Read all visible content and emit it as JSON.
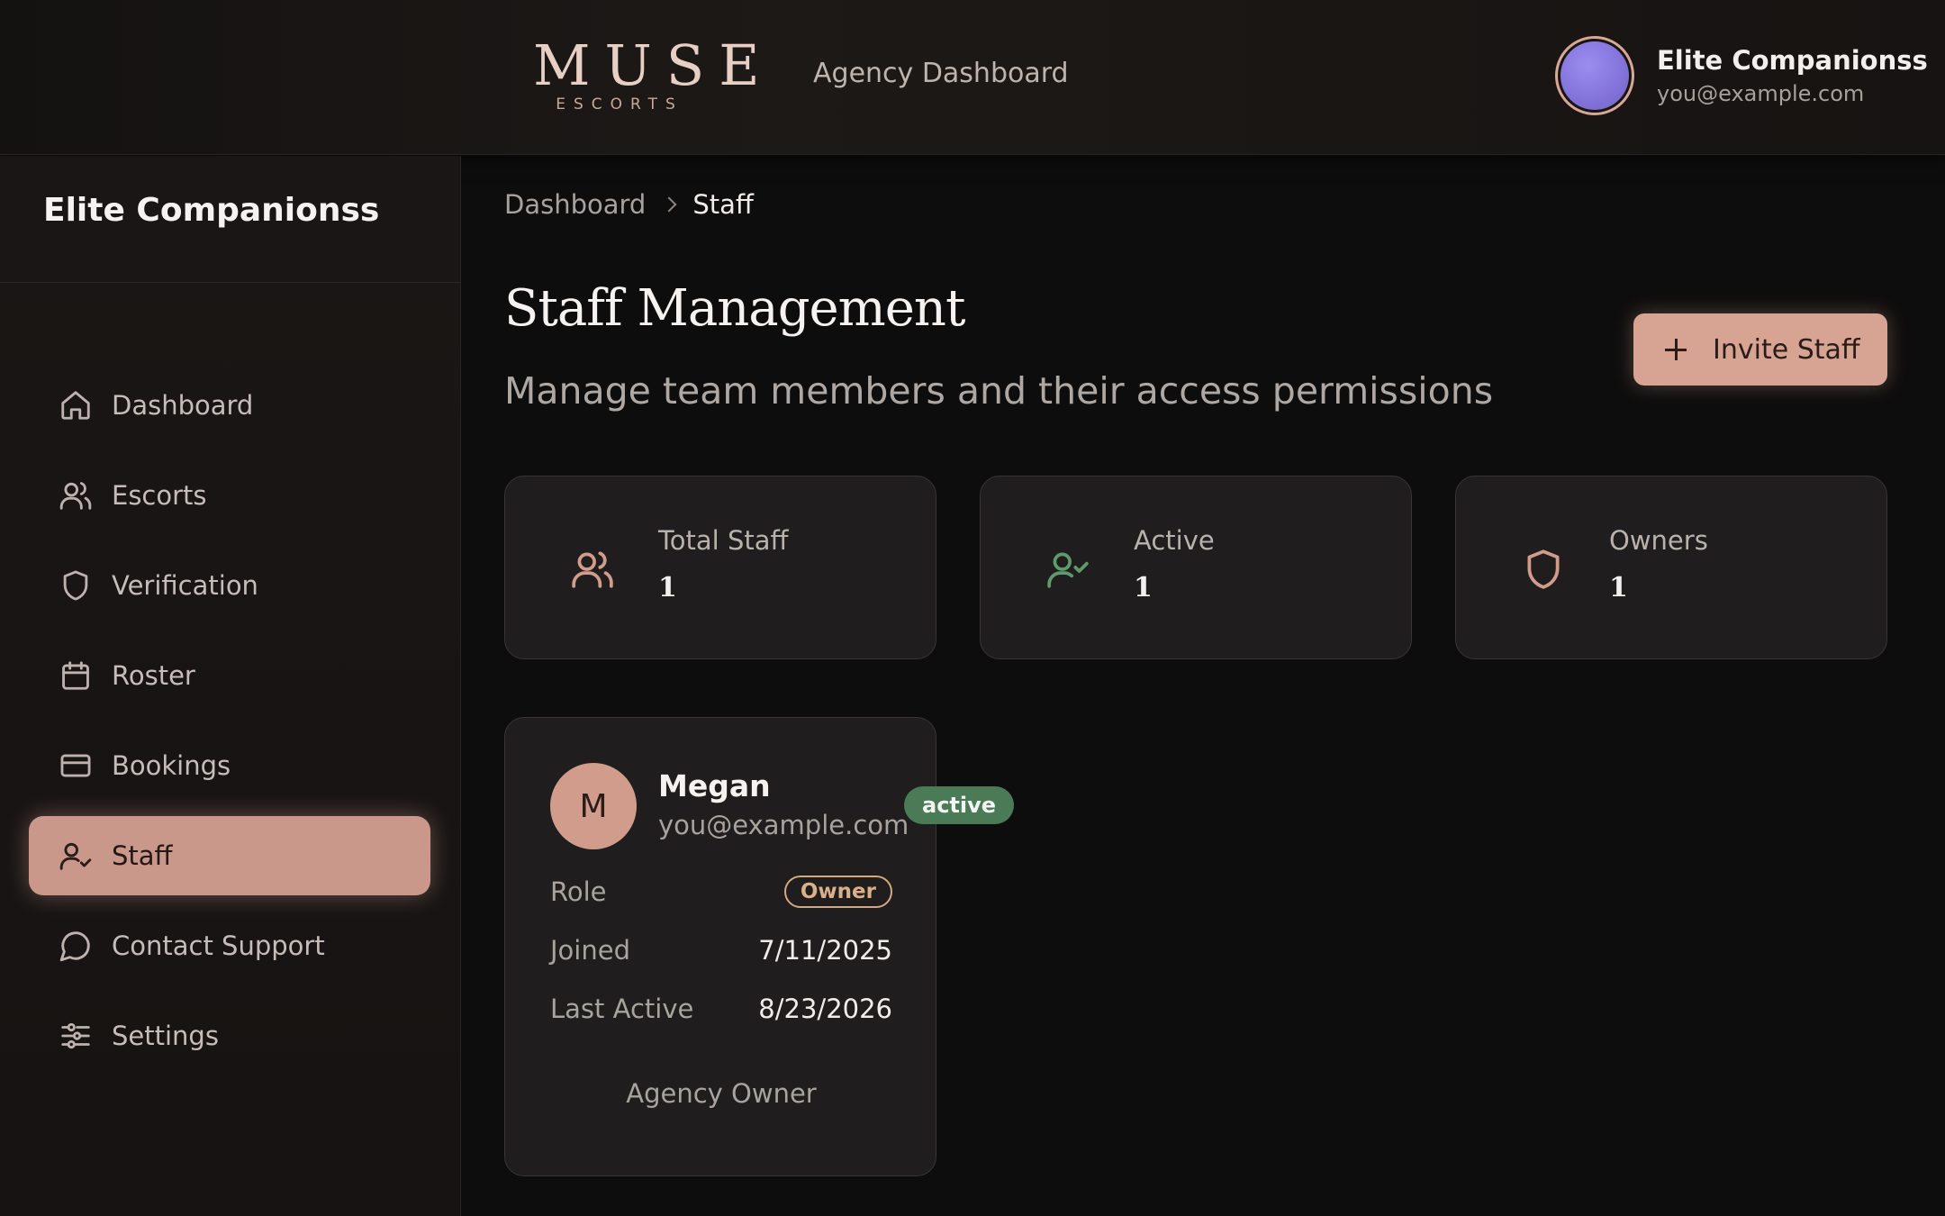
{
  "header": {
    "logo_main": "MUSE",
    "logo_sub": "ESCORTS",
    "title": "Agency Dashboard",
    "user_name": "Elite Companionss",
    "user_email": "you@example.com"
  },
  "sidebar": {
    "title": "Elite Companionss",
    "items": [
      {
        "label": "Dashboard",
        "icon": "home-icon",
        "active": false
      },
      {
        "label": "Escorts",
        "icon": "users-icon",
        "active": false
      },
      {
        "label": "Verification",
        "icon": "shield-icon",
        "active": false
      },
      {
        "label": "Roster",
        "icon": "calendar-icon",
        "active": false
      },
      {
        "label": "Bookings",
        "icon": "credit-card-icon",
        "active": false
      },
      {
        "label": "Staff",
        "icon": "user-check-icon",
        "active": true
      },
      {
        "label": "Contact Support",
        "icon": "message-circle-icon",
        "active": false
      },
      {
        "label": "Settings",
        "icon": "sliders-icon",
        "active": false
      }
    ]
  },
  "breadcrumb": {
    "parent": "Dashboard",
    "current": "Staff"
  },
  "page": {
    "title": "Staff Management",
    "subtitle": "Manage team members and their access permissions",
    "invite_label": "Invite Staff"
  },
  "stats": [
    {
      "label": "Total Staff",
      "value": "1",
      "icon": "users-icon",
      "color": "#d29c8c"
    },
    {
      "label": "Active",
      "value": "1",
      "icon": "user-check-icon",
      "color": "#5f9a6c"
    },
    {
      "label": "Owners",
      "value": "1",
      "icon": "shield-icon",
      "color": "#d29c8c"
    }
  ],
  "staff": [
    {
      "initial": "M",
      "name": "Megan",
      "email": "you@example.com",
      "status": "active",
      "role_label": "Role",
      "role": "Owner",
      "joined_label": "Joined",
      "joined": "7/11/2025",
      "last_active_label": "Last Active",
      "last_active": "8/23/2026",
      "footer": "Agency Owner"
    }
  ],
  "colors": {
    "accent": "#d7a393",
    "active_status": "#4b7a56",
    "owner_badge": "#d5a97f"
  }
}
